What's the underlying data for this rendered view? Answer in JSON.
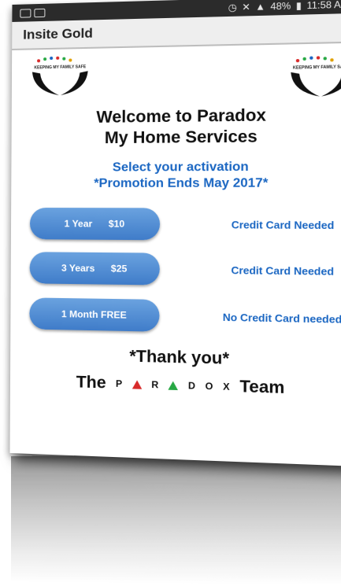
{
  "status_bar": {
    "battery": "48%",
    "time": "11:58 AM"
  },
  "app": {
    "title": "Insite Gold"
  },
  "logo": {
    "text": "KEEPING MY FAMILY SAFE"
  },
  "welcome": {
    "line1": "Welcome to Paradox",
    "line2": "My Home Services"
  },
  "activation": {
    "line1": "Select your activation",
    "line2": "*Promotion Ends May 2017*"
  },
  "plans": [
    {
      "label": "1 Year",
      "price": "$10",
      "note": "Credit Card Needed"
    },
    {
      "label": "3 Years",
      "price": "$25",
      "note": "Credit Card Needed"
    },
    {
      "label": "1 Month FREE",
      "price": "",
      "note": "No Credit Card needed"
    }
  ],
  "footer": {
    "thanks": "*Thank you*",
    "team_prefix": "The",
    "brand_letters": [
      "P",
      "R",
      "D",
      "O",
      "X"
    ],
    "team_suffix": "Team"
  },
  "colors": {
    "accent": "#1a66c2",
    "button": "#4f8bd6",
    "triangle_red": "#d82a2a",
    "triangle_green": "#27a844"
  }
}
